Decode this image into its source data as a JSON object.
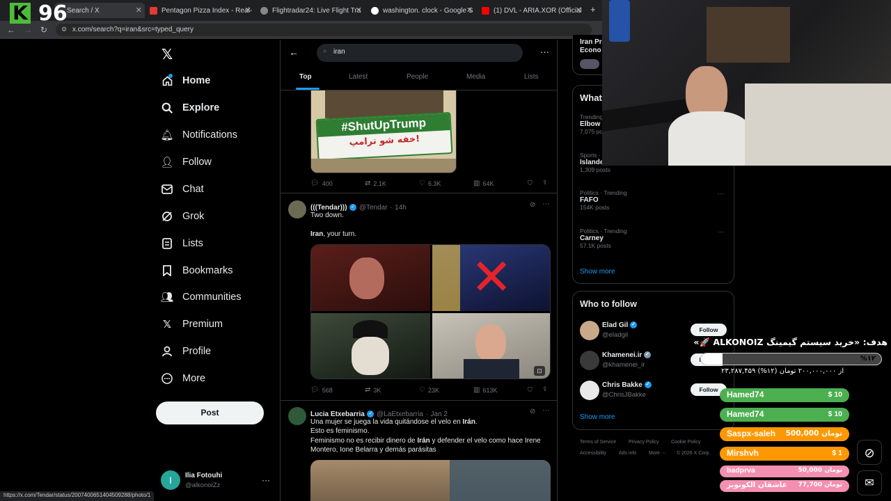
{
  "browser": {
    "tabs": [
      {
        "title": "Search / X"
      },
      {
        "title": "Pentagon Pizza Index - Real-"
      },
      {
        "title": "Flightradar24: Live Flight Tra"
      },
      {
        "title": "washington. clock - Google S"
      },
      {
        "title": "(1) DVL - ARIA.XOR (Official"
      }
    ],
    "url": "x.com/search?q=iran&src=typed_query",
    "status_url": "https://x.com/Tendar/status/2007400651404509288/photo/1"
  },
  "stream": {
    "logo_letter": "K",
    "logo_number": "96",
    "goal_text": "هدف: «خرید سیستم گیمینگ ALKONOIZ 🚀»",
    "goal_percent": "%۱۲",
    "goal_progress": 0.12,
    "goal_detail": "۲۳,۲۸۷,۴۵۹ از ۲۰۰,۰۰۰,۰۰۰ تومان (۱۲%)",
    "donations": [
      {
        "name": "Hamed74",
        "amount": "$ 10",
        "color": "#4caf50"
      },
      {
        "name": "Hamed74",
        "amount": "$ 10",
        "color": "#4caf50"
      },
      {
        "name": "Saspx-saleh",
        "amount": "500,000 تومان",
        "color": "#ff9800"
      },
      {
        "name": "Mirshvh",
        "amount": "$ 1",
        "color": "#ff9800"
      },
      {
        "name": "badprva",
        "amount": "50,000 تومان",
        "color": "#f48fb1"
      },
      {
        "name": "عاشقان الکونویز",
        "amount": "77,700 تومان",
        "color": "#f48fb1"
      }
    ]
  },
  "sidebar": {
    "items": [
      {
        "label": "Home",
        "icon": "home-icon"
      },
      {
        "label": "Explore",
        "icon": "search-icon"
      },
      {
        "label": "Notifications",
        "icon": "bell-icon"
      },
      {
        "label": "Follow",
        "icon": "person-plus-icon"
      },
      {
        "label": "Chat",
        "icon": "mail-icon"
      },
      {
        "label": "Grok",
        "icon": "grok-icon"
      },
      {
        "label": "Lists",
        "icon": "list-icon"
      },
      {
        "label": "Bookmarks",
        "icon": "bookmark-icon"
      },
      {
        "label": "Communities",
        "icon": "people-icon"
      },
      {
        "label": "Premium",
        "icon": "x-icon"
      },
      {
        "label": "Profile",
        "icon": "person-icon"
      },
      {
        "label": "More",
        "icon": "more-circle-icon"
      }
    ],
    "post_label": "Post",
    "account": {
      "name": "Ilia Fotouhi",
      "handle": "@alkonoiZz",
      "initial": "I"
    }
  },
  "search": {
    "query": "iran",
    "tabs": [
      "Top",
      "Latest",
      "People",
      "Media",
      "Lists"
    ]
  },
  "posts": [
    {
      "image_text_en": "#ShutUpTrump",
      "image_text_fa": "خفه شو ترامپ!",
      "replies": "400",
      "reposts": "2.1K",
      "likes": "6.3K",
      "views": "64K"
    },
    {
      "name": "(((Tendar)))",
      "handle": "@Tendar",
      "time": "14h",
      "line1": "Two down.",
      "line2_bold": "Iran",
      "line2_rest": ", your turn.",
      "replies": "568",
      "reposts": "3K",
      "likes": "23K",
      "views": "613K"
    },
    {
      "name": "Lucia Etxebarria",
      "handle": "@LaEtxebarria",
      "time": "Jan 2",
      "l1a": "Una mujer se juega la vida quitándose el velo en ",
      "l1b": "Irán",
      "l1c": ".",
      "l2": "Esto es feminismo.",
      "l3a": "Feminismo no es recibir dinero de ",
      "l3b": "Irán",
      "l3c": " y defender el velo como hace Irene",
      "l4": "Montero, Ione Belarra y demás parásitas"
    }
  ],
  "right": {
    "partial_title": "Iran Pr",
    "partial_sub": "Econo",
    "whats_happening": "What",
    "trends": [
      {
        "ctx": "Trending",
        "name": "Elbow",
        "posts": "7,075 po"
      },
      {
        "ctx": "Sports · ",
        "name": "Islande",
        "posts": "1,309 posts"
      },
      {
        "ctx": "Politics · Trending",
        "name": "FAFO",
        "posts": "154K posts"
      },
      {
        "ctx": "Politics · Trending",
        "name": "Carney",
        "posts": "57.1K posts"
      }
    ],
    "show_more": "Show more",
    "who_to_follow": "Who to follow",
    "follow_label": "Follow",
    "suggestions": [
      {
        "name": "Elad Gil",
        "handle": "@eladgil"
      },
      {
        "name": "Khamenei.ir",
        "handle": "@khamenei_ir"
      },
      {
        "name": "Chris Bakke",
        "handle": "@ChrisJBakke"
      }
    ],
    "footer": [
      "Terms of Service",
      "Privacy Policy",
      "Cookie Policy",
      "Accessibility",
      "Ads info",
      "More ···",
      "© 2026 X Corp."
    ]
  }
}
